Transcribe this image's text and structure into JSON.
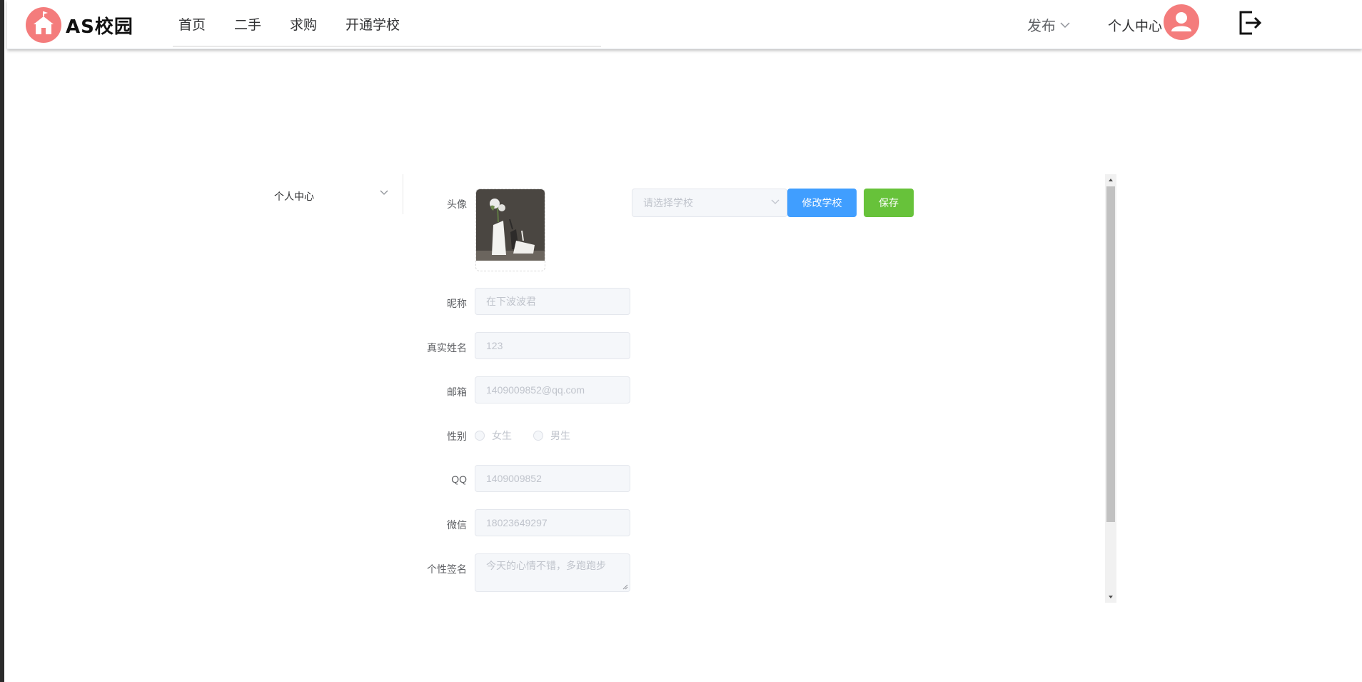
{
  "header": {
    "logo_text": "AS校园",
    "nav": [
      "首页",
      "二手",
      "求购",
      "开通学校"
    ],
    "publish_label": "发布",
    "personal_center_label": "个人中心"
  },
  "side_menu": {
    "label": "个人中心"
  },
  "form": {
    "avatar_label": "头像",
    "nickname_label": "昵称",
    "nickname_value": "在下波波君",
    "realname_label": "真实姓名",
    "realname_value": "123",
    "email_label": "邮箱",
    "email_value": "1409009852@qq.com",
    "gender_label": "性别",
    "gender_options": [
      "女生",
      "男生"
    ],
    "qq_label": "QQ",
    "qq_value": "1409009852",
    "wechat_label": "微信",
    "wechat_value": "18023649297",
    "signature_label": "个性签名",
    "signature_value": "今天的心情不错，多跑跑步"
  },
  "school": {
    "select_placeholder": "请选择学校",
    "modify_button": "修改学校",
    "save_button": "保存"
  },
  "colors": {
    "accent_blue": "#409eff",
    "accent_green": "#67c23a",
    "avatar_pink": "#f47c7c"
  }
}
